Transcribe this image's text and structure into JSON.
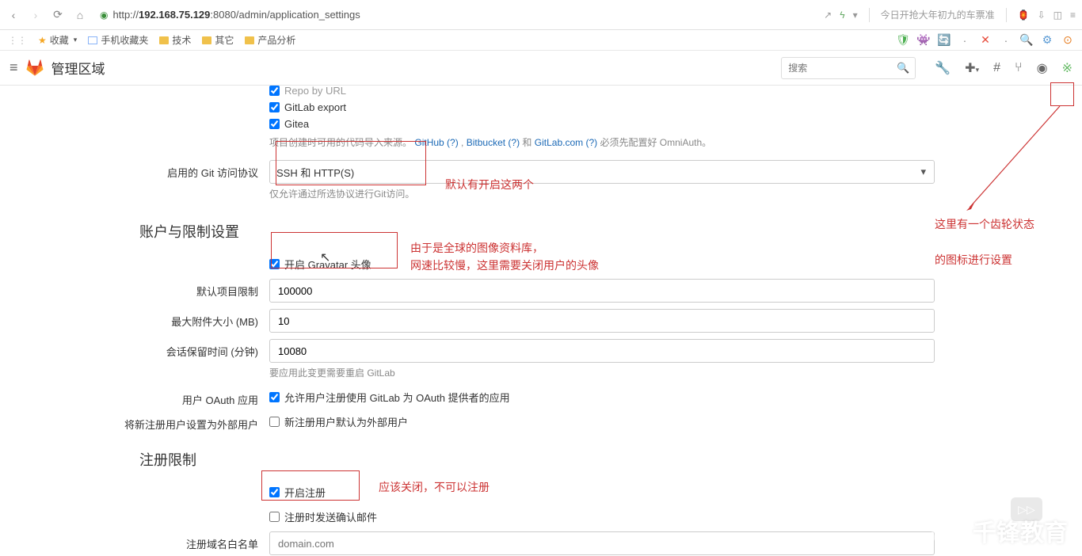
{
  "browser": {
    "url_prefix": "http://",
    "url_host": "192.168.75.129",
    "url_path": ":8080/admin/application_settings",
    "right_link": "今日开抢大年初九的车票准"
  },
  "bookmarks": {
    "fav": "收藏",
    "items": [
      "手机收藏夹",
      "技术",
      "其它",
      "产品分析"
    ]
  },
  "gitlab": {
    "title": "管理区域",
    "search_placeholder": "搜索"
  },
  "import_sources": {
    "items": [
      {
        "label": "Repo by URL",
        "checked": true
      },
      {
        "label": "GitLab export",
        "checked": true
      },
      {
        "label": "Gitea",
        "checked": true
      }
    ],
    "help_pre": "项目创建时可用的代码导入来源。",
    "help_links": "GitHub (?) , Bitbucket (?) 和 GitLab.com (?)",
    "help_post": " 必须先配置好 OmniAuth。"
  },
  "git_proto": {
    "label": "启用的 Git 访问协议",
    "value": "SSH 和 HTTP(S)",
    "help": "仅允许通过所选协议进行Git访问。"
  },
  "sec_account": "账户与限制设置",
  "gravatar": {
    "label": "开启 Gravatar 头像",
    "checked": true
  },
  "def_limit": {
    "label": "默认项目限制",
    "value": "100000"
  },
  "max_attach": {
    "label": "最大附件大小 (MB)",
    "value": "10"
  },
  "session": {
    "label": "会话保留时间 (分钟)",
    "value": "10080",
    "help": "要应用此变更需要重启 GitLab"
  },
  "oauth": {
    "label": "用户 OAuth 应用",
    "chk": "允许用户注册使用 GitLab 为 OAuth 提供者的应用",
    "checked": true
  },
  "ext_user": {
    "label": "将新注册用户设置为外部用户",
    "chk": "新注册用户默认为外部用户",
    "checked": false
  },
  "sec_signup": "注册限制",
  "signup": {
    "label": "开启注册",
    "checked": true
  },
  "confirm_email": {
    "label": "注册时发送确认邮件",
    "checked": false
  },
  "whitelist": {
    "label": "注册域名白名单",
    "placeholder": "domain.com"
  },
  "annotations": {
    "a1": "默认有开启这两个",
    "a2_l1": "由于是全球的图像资料库，",
    "a2_l2": "网速比较慢，这里需要关闭用户的头像",
    "a3_l1": "这里有一个齿轮状态",
    "a3_l2": "的图标进行设置",
    "a4": "应该关闭，不可以注册"
  },
  "watermark": "千锋教育"
}
